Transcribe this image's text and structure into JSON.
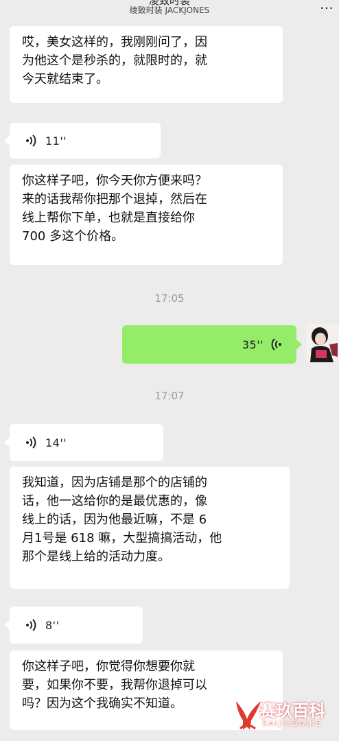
{
  "header": {
    "title_partial": "凌致时装",
    "subtitle": "绫致时装 JACKJONES",
    "more_icon": "more-dots-icon"
  },
  "messages": [
    {
      "type": "text",
      "direction": "in",
      "text": "哎，美女这样的，我刚刚问了，因\n为他这个是秒杀的，就限时的，就\n今天就结束了。"
    },
    {
      "type": "voice",
      "direction": "in",
      "duration": "11''"
    },
    {
      "type": "text",
      "direction": "in",
      "text": "你这样子吧，你今天你方便来吗？\n来的话我帮你把那个退掉，然后在\n线上帮你下单，也就是直接给你\n700 多这个价格。"
    },
    {
      "type": "timestamp",
      "text": "17:05"
    },
    {
      "type": "voice",
      "direction": "out",
      "duration": "35''"
    },
    {
      "type": "timestamp",
      "text": "17:07"
    },
    {
      "type": "voice",
      "direction": "in",
      "duration": "14''"
    },
    {
      "type": "text",
      "direction": "in",
      "text": "我知道，因为店铺是那个的店铺的\n话，他一这给你的是最优惠的，像\n线上的话，因为他最近嘛，不是 6\n月1号是 618 嘛，大型搞搞活动，他\n那个是线上给的活动力度。"
    },
    {
      "type": "voice",
      "direction": "in",
      "duration": "8''"
    },
    {
      "type": "text",
      "direction": "in",
      "text": "你这样子吧，你觉得你想要你就\n要，如果你不要，我帮你退掉可以\n吗？因为这个我确实不知道。"
    }
  ],
  "watermark": {
    "main": "赛玖百科",
    "sub": "SAIJIUBAIKE"
  },
  "colors": {
    "background": "#ececec",
    "incoming_bubble": "#ffffff",
    "outgoing_bubble": "#95ec69",
    "timestamp": "#9b9b9b",
    "watermark_brand": "#e03a2e"
  }
}
